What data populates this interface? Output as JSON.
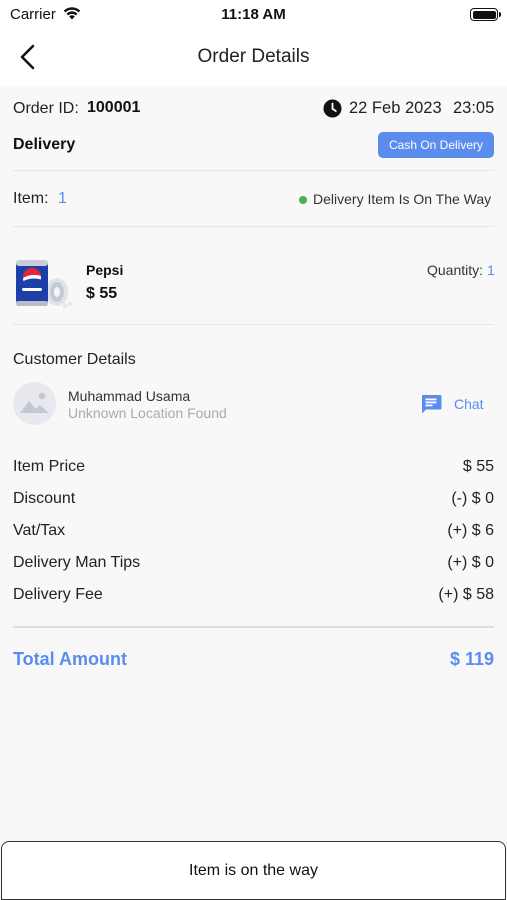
{
  "status_bar": {
    "carrier": "Carrier",
    "time": "11:18 AM"
  },
  "nav": {
    "title": "Order Details"
  },
  "order": {
    "id_label": "Order ID:",
    "id_value": "100001",
    "date": "22 Feb 2023",
    "time": "23:05",
    "type": "Delivery",
    "payment_method": "Cash On Delivery"
  },
  "items_summary": {
    "label": "Item:",
    "count": "1",
    "status": "Delivery Item Is On The Way",
    "status_color": "#4caf50"
  },
  "product": {
    "name": "Pepsi",
    "price": "$ 55",
    "quantity_label": "Quantity:",
    "quantity": "1",
    "icon": "pepsi-can-image"
  },
  "customer": {
    "section_title": "Customer Details",
    "name": "Muhammad Usama",
    "location": "Unknown Location Found",
    "chat_label": "Chat"
  },
  "pricing": [
    {
      "label": "Item Price",
      "value": "$ 55"
    },
    {
      "label": "Discount",
      "value": "(-) $ 0"
    },
    {
      "label": "Vat/Tax",
      "value": "(+) $ 6"
    },
    {
      "label": "Delivery Man Tips",
      "value": "(+) $ 0"
    },
    {
      "label": "Delivery Fee",
      "value": "(+) $ 58"
    }
  ],
  "total": {
    "label": "Total Amount",
    "value": "$ 119"
  },
  "action": {
    "label": "Item is on the way"
  },
  "colors": {
    "accent": "#5b8def",
    "status_green": "#4caf50",
    "background": "#f8f8f9"
  }
}
